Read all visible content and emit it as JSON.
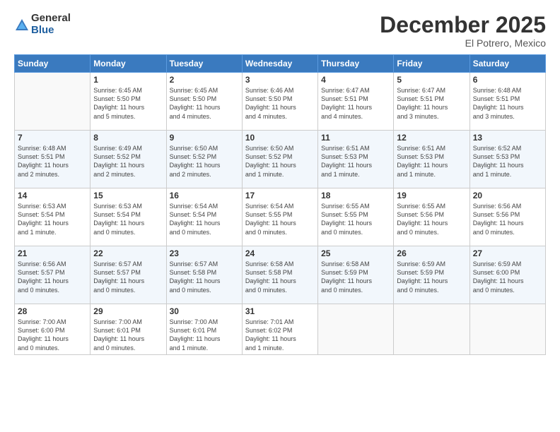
{
  "logo": {
    "general": "General",
    "blue": "Blue"
  },
  "header": {
    "month": "December 2025",
    "location": "El Potrero, Mexico"
  },
  "weekdays": [
    "Sunday",
    "Monday",
    "Tuesday",
    "Wednesday",
    "Thursday",
    "Friday",
    "Saturday"
  ],
  "weeks": [
    [
      {
        "day": "",
        "info": ""
      },
      {
        "day": "1",
        "info": "Sunrise: 6:45 AM\nSunset: 5:50 PM\nDaylight: 11 hours\nand 5 minutes."
      },
      {
        "day": "2",
        "info": "Sunrise: 6:45 AM\nSunset: 5:50 PM\nDaylight: 11 hours\nand 4 minutes."
      },
      {
        "day": "3",
        "info": "Sunrise: 6:46 AM\nSunset: 5:50 PM\nDaylight: 11 hours\nand 4 minutes."
      },
      {
        "day": "4",
        "info": "Sunrise: 6:47 AM\nSunset: 5:51 PM\nDaylight: 11 hours\nand 4 minutes."
      },
      {
        "day": "5",
        "info": "Sunrise: 6:47 AM\nSunset: 5:51 PM\nDaylight: 11 hours\nand 3 minutes."
      },
      {
        "day": "6",
        "info": "Sunrise: 6:48 AM\nSunset: 5:51 PM\nDaylight: 11 hours\nand 3 minutes."
      }
    ],
    [
      {
        "day": "7",
        "info": "Sunrise: 6:48 AM\nSunset: 5:51 PM\nDaylight: 11 hours\nand 2 minutes."
      },
      {
        "day": "8",
        "info": "Sunrise: 6:49 AM\nSunset: 5:52 PM\nDaylight: 11 hours\nand 2 minutes."
      },
      {
        "day": "9",
        "info": "Sunrise: 6:50 AM\nSunset: 5:52 PM\nDaylight: 11 hours\nand 2 minutes."
      },
      {
        "day": "10",
        "info": "Sunrise: 6:50 AM\nSunset: 5:52 PM\nDaylight: 11 hours\nand 1 minute."
      },
      {
        "day": "11",
        "info": "Sunrise: 6:51 AM\nSunset: 5:53 PM\nDaylight: 11 hours\nand 1 minute."
      },
      {
        "day": "12",
        "info": "Sunrise: 6:51 AM\nSunset: 5:53 PM\nDaylight: 11 hours\nand 1 minute."
      },
      {
        "day": "13",
        "info": "Sunrise: 6:52 AM\nSunset: 5:53 PM\nDaylight: 11 hours\nand 1 minute."
      }
    ],
    [
      {
        "day": "14",
        "info": "Sunrise: 6:53 AM\nSunset: 5:54 PM\nDaylight: 11 hours\nand 1 minute."
      },
      {
        "day": "15",
        "info": "Sunrise: 6:53 AM\nSunset: 5:54 PM\nDaylight: 11 hours\nand 0 minutes."
      },
      {
        "day": "16",
        "info": "Sunrise: 6:54 AM\nSunset: 5:54 PM\nDaylight: 11 hours\nand 0 minutes."
      },
      {
        "day": "17",
        "info": "Sunrise: 6:54 AM\nSunset: 5:55 PM\nDaylight: 11 hours\nand 0 minutes."
      },
      {
        "day": "18",
        "info": "Sunrise: 6:55 AM\nSunset: 5:55 PM\nDaylight: 11 hours\nand 0 minutes."
      },
      {
        "day": "19",
        "info": "Sunrise: 6:55 AM\nSunset: 5:56 PM\nDaylight: 11 hours\nand 0 minutes."
      },
      {
        "day": "20",
        "info": "Sunrise: 6:56 AM\nSunset: 5:56 PM\nDaylight: 11 hours\nand 0 minutes."
      }
    ],
    [
      {
        "day": "21",
        "info": "Sunrise: 6:56 AM\nSunset: 5:57 PM\nDaylight: 11 hours\nand 0 minutes."
      },
      {
        "day": "22",
        "info": "Sunrise: 6:57 AM\nSunset: 5:57 PM\nDaylight: 11 hours\nand 0 minutes."
      },
      {
        "day": "23",
        "info": "Sunrise: 6:57 AM\nSunset: 5:58 PM\nDaylight: 11 hours\nand 0 minutes."
      },
      {
        "day": "24",
        "info": "Sunrise: 6:58 AM\nSunset: 5:58 PM\nDaylight: 11 hours\nand 0 minutes."
      },
      {
        "day": "25",
        "info": "Sunrise: 6:58 AM\nSunset: 5:59 PM\nDaylight: 11 hours\nand 0 minutes."
      },
      {
        "day": "26",
        "info": "Sunrise: 6:59 AM\nSunset: 5:59 PM\nDaylight: 11 hours\nand 0 minutes."
      },
      {
        "day": "27",
        "info": "Sunrise: 6:59 AM\nSunset: 6:00 PM\nDaylight: 11 hours\nand 0 minutes."
      }
    ],
    [
      {
        "day": "28",
        "info": "Sunrise: 7:00 AM\nSunset: 6:00 PM\nDaylight: 11 hours\nand 0 minutes."
      },
      {
        "day": "29",
        "info": "Sunrise: 7:00 AM\nSunset: 6:01 PM\nDaylight: 11 hours\nand 0 minutes."
      },
      {
        "day": "30",
        "info": "Sunrise: 7:00 AM\nSunset: 6:01 PM\nDaylight: 11 hours\nand 1 minute."
      },
      {
        "day": "31",
        "info": "Sunrise: 7:01 AM\nSunset: 6:02 PM\nDaylight: 11 hours\nand 1 minute."
      },
      {
        "day": "",
        "info": ""
      },
      {
        "day": "",
        "info": ""
      },
      {
        "day": "",
        "info": ""
      }
    ]
  ]
}
